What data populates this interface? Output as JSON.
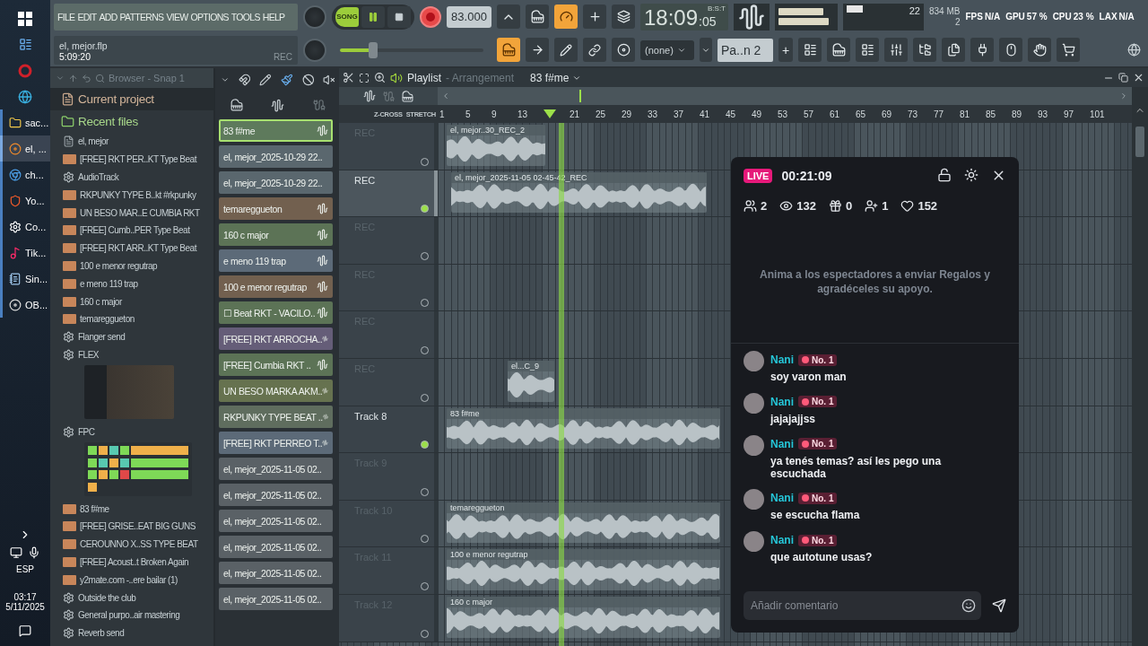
{
  "taskbar": {
    "apps": [
      {
        "label": "sac...",
        "active": false
      },
      {
        "label": "el, ...",
        "active": true
      },
      {
        "label": "ch...",
        "active": false
      },
      {
        "label": "Yo...",
        "active": false
      },
      {
        "label": "Co...",
        "active": false
      },
      {
        "label": "Tik...",
        "active": false
      },
      {
        "label": "Sin...",
        "active": false
      },
      {
        "label": "OB...",
        "active": false
      }
    ],
    "language": "ESP",
    "time": "03:17",
    "date": "5/11/2025"
  },
  "toolbar": {
    "menu": [
      "FILE",
      "EDIT",
      "ADD",
      "PATTERNS",
      "VIEW",
      "OPTIONS",
      "TOOLS",
      "HELP"
    ],
    "project": {
      "file": "el, mejor.flp",
      "time": "5:09:20",
      "rec": "REC"
    },
    "mode": {
      "label": "SONG",
      "on": true
    },
    "tempo": "83.000",
    "clock": {
      "main": "18:09",
      "seconds": ":05",
      "format": "B:S:T"
    },
    "polyphony": "22",
    "memory": "834 MB",
    "memory_sub": "2",
    "stats": [
      {
        "label": "FPS",
        "value": "N/A"
      },
      {
        "label": "GPU",
        "value": "57 %"
      },
      {
        "label": "CPU",
        "value": "23 %"
      },
      {
        "label": "LAX",
        "value": "N/A"
      }
    ],
    "master_volume": {
      "level": 0.23
    },
    "snap": "(none)",
    "pattern": "Pa..n 2",
    "add_pattern": "+"
  },
  "browser": {
    "title": "Browser - Snap 1",
    "items": [
      {
        "label": "Current project",
        "kind": "current-project"
      },
      {
        "label": "Recent files",
        "kind": "recent-files"
      },
      {
        "label": "el, mejor",
        "kind": "project-file"
      },
      {
        "label": "[FREE] RKT PER..KT Type Beat",
        "kind": "audio"
      },
      {
        "label": "AudioTrack",
        "kind": "plugin"
      },
      {
        "label": "RKPUNKY TYPE B..kt #rkpunky",
        "kind": "audio"
      },
      {
        "label": "UN BESO MAR..E CUMBIA RKT",
        "kind": "audio"
      },
      {
        "label": "[FREE] Cumb..PER Type Beat",
        "kind": "audio"
      },
      {
        "label": "[FREE] RKT ARR..KT Type Beat",
        "kind": "audio"
      },
      {
        "label": "100 e menor regutrap",
        "kind": "audio"
      },
      {
        "label": "e meno 119 trap",
        "kind": "audio"
      },
      {
        "label": "160 c major",
        "kind": "audio"
      },
      {
        "label": "temareggueton",
        "kind": "audio"
      },
      {
        "label": "Flanger send",
        "kind": "plugin"
      },
      {
        "label": "FLEX",
        "kind": "plugin-synth"
      },
      {
        "label": "FPC",
        "kind": "plugin-pads"
      },
      {
        "label": "83 f#me",
        "kind": "audio"
      },
      {
        "label": "[FREE] GRISE..EAT BIG GUNS",
        "kind": "audio"
      },
      {
        "label": "CEROUNNO X..SS TYPE BEAT",
        "kind": "audio"
      },
      {
        "label": "[FREE] Acoust..t Broken Again",
        "kind": "audio"
      },
      {
        "label": "y2mate.com -..ere bailar (1)",
        "kind": "audio"
      },
      {
        "label": "Outside the club",
        "kind": "plugin"
      },
      {
        "label": "General purpo..air mastering",
        "kind": "plugin"
      },
      {
        "label": "Reverb send",
        "kind": "plugin"
      }
    ]
  },
  "clips": [
    {
      "name": "83 f#me",
      "kind": "audio",
      "color": "#5e7a5c",
      "selected": true
    },
    {
      "name": "el, mejor_2025-10-29 22..",
      "kind": "recording",
      "color": "#5a676e",
      "selected": false
    },
    {
      "name": "el, mejor_2025-10-29 22..",
      "kind": "recording",
      "color": "#5a676e",
      "selected": false
    },
    {
      "name": "temareggueton",
      "kind": "audio",
      "color": "#72604f",
      "selected": false
    },
    {
      "name": "160 c major",
      "kind": "audio",
      "color": "#5c7356",
      "selected": false
    },
    {
      "name": "e meno 119 trap",
      "kind": "audio",
      "color": "#5c6a78",
      "selected": false
    },
    {
      "name": "100 e menor regutrap",
      "kind": "audio",
      "color": "#72604f",
      "selected": false
    },
    {
      "name": "☐ Beat RKT - VACILO..",
      "kind": "audio",
      "color": "#5c7356",
      "selected": false
    },
    {
      "name": "[FREE] RKT ARROCHA..",
      "kind": "audio",
      "color": "#655d78",
      "selected": false
    },
    {
      "name": "[FREE] Cumbia RKT ..",
      "kind": "audio",
      "color": "#5c7356",
      "selected": false
    },
    {
      "name": "UN BESO MARKA AKM..",
      "kind": "audio",
      "color": "#66724f",
      "selected": false
    },
    {
      "name": "RKPUNKY TYPE BEAT ..",
      "kind": "audio",
      "color": "#5f6d5e",
      "selected": false
    },
    {
      "name": "[FREE] RKT PERREO T..",
      "kind": "audio",
      "color": "#5c6a78",
      "selected": false
    },
    {
      "name": "el, mejor_2025-11-05 02..",
      "kind": "recording",
      "color": "#5a6166",
      "selected": false
    },
    {
      "name": "el, mejor_2025-11-05 02..",
      "kind": "recording",
      "color": "#5a6166",
      "selected": false
    },
    {
      "name": "el, mejor_2025-11-05 02..",
      "kind": "recording",
      "color": "#5a6166",
      "selected": false
    },
    {
      "name": "el, mejor_2025-11-05 02..",
      "kind": "recording",
      "color": "#5a6166",
      "selected": false
    },
    {
      "name": "el, mejor_2025-11-05 02..",
      "kind": "recording",
      "color": "#5a6166",
      "selected": false
    },
    {
      "name": "el, mejor_2025-11-05 02..",
      "kind": "recording",
      "color": "#5a6166",
      "selected": false
    }
  ],
  "playlist": {
    "title": "Playlist",
    "subtitle": "- Arrangement",
    "pattern": "83 f#me",
    "zero_cross": "Z-CROSS",
    "stretch": "STRETCH",
    "bars": [
      "1",
      "5",
      "9",
      "13",
      "21",
      "25",
      "29",
      "33",
      "37",
      "41",
      "45",
      "49",
      "53",
      "57",
      "61",
      "65",
      "69",
      "73",
      "77",
      "81",
      "85",
      "89",
      "93",
      "97",
      "101"
    ],
    "tracks": [
      {
        "name": "REC",
        "selected": false,
        "highlighted": false,
        "clip": "el, mejor..30_REC_2"
      },
      {
        "name": "REC",
        "selected": true,
        "highlighted": true,
        "clip": "el, mejor_2025-11-05 02-45-42_REC"
      },
      {
        "name": "REC",
        "selected": false,
        "highlighted": false
      },
      {
        "name": "REC",
        "selected": false,
        "highlighted": false
      },
      {
        "name": "REC",
        "selected": false,
        "highlighted": false
      },
      {
        "name": "REC",
        "selected": false,
        "highlighted": false,
        "clip": "el...C_9"
      },
      {
        "name": "Track 8",
        "selected": false,
        "highlighted": true,
        "clip": "83 f#me"
      },
      {
        "name": "Track 9",
        "selected": false,
        "highlighted": false
      },
      {
        "name": "Track 10",
        "selected": false,
        "highlighted": false,
        "clip": "temareggueton"
      },
      {
        "name": "Track 11",
        "selected": false,
        "highlighted": false,
        "clip": "100 e menor regutrap"
      },
      {
        "name": "Track 12",
        "selected": false,
        "highlighted": false,
        "clip": "160 c major"
      }
    ]
  },
  "live": {
    "badge": "LIVE",
    "duration": "00:21:09",
    "stats": [
      "2",
      "132",
      "0",
      "1",
      "152"
    ],
    "hint": "Anima a los espectadores a enviar Regalos y agradéceles su apoyo.",
    "messages": [
      {
        "user": "Nani",
        "rank": "No. 1",
        "text": "soy varon man"
      },
      {
        "user": "Nani",
        "rank": "No. 1",
        "text": "jajajajjss"
      },
      {
        "user": "Nani",
        "rank": "No. 1",
        "text": "ya tenés temas? así les pego una escuchada"
      },
      {
        "user": "Nani",
        "rank": "No. 1",
        "text": "se escucha flama"
      },
      {
        "user": "Nani",
        "rank": "No. 1",
        "text": "que autotune usas?"
      }
    ],
    "comment": {
      "placeholder": "Añadir comentario"
    }
  }
}
